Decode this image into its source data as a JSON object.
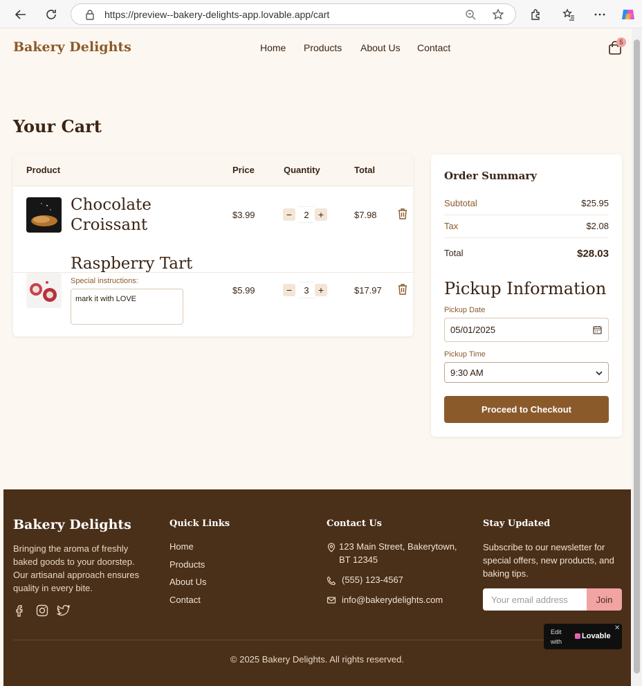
{
  "browser": {
    "url": "https://preview--bakery-delights-app.lovable.app/cart"
  },
  "header": {
    "logo": "Bakery Delights",
    "nav": [
      "Home",
      "Products",
      "About Us",
      "Contact"
    ],
    "cart_count": "5"
  },
  "cart": {
    "title": "Your Cart",
    "columns": [
      "Product",
      "Price",
      "Quantity",
      "Total"
    ],
    "items": [
      {
        "name_line1": "Chocolate",
        "name_line2": "Croissant",
        "price": "$3.99",
        "qty": "2",
        "total": "$7.98"
      },
      {
        "name_line1": "Raspberry Tart",
        "price": "$5.99",
        "qty": "3",
        "total": "$17.97",
        "special_label": "Special instructions:",
        "special_value": "mark it with LOVE"
      }
    ]
  },
  "summary": {
    "title": "Order Summary",
    "subtotal_label": "Subtotal",
    "subtotal": "$25.95",
    "tax_label": "Tax",
    "tax": "$2.08",
    "total_label": "Total",
    "total": "$28.03",
    "pickup_title": "Pickup Information",
    "date_label": "Pickup Date",
    "date_value": "05/01/2025",
    "time_label": "Pickup Time",
    "time_value": "9:30 AM",
    "checkout": "Proceed to Checkout"
  },
  "footer": {
    "logo": "Bakery Delights",
    "tagline": "Bringing the aroma of freshly baked goods to your doorstep. Our artisanal approach ensures quality in every bite.",
    "quick_links_title": "Quick Links",
    "quick_links": [
      "Home",
      "Products",
      "About Us",
      "Contact"
    ],
    "contact_title": "Contact Us",
    "address": "123 Main Street, Bakerytown, BT 12345",
    "phone": "(555) 123-4567",
    "email": "info@bakerydelights.com",
    "newsletter_title": "Stay Updated",
    "newsletter_text": "Subscribe to our newsletter for special offers, new products, and baking tips.",
    "email_placeholder": "Your email address",
    "join": "Join",
    "copyright": "© 2025 Bakery Delights. All rights reserved."
  },
  "badge": {
    "edit": "Edit with",
    "brand": "Lovable"
  }
}
